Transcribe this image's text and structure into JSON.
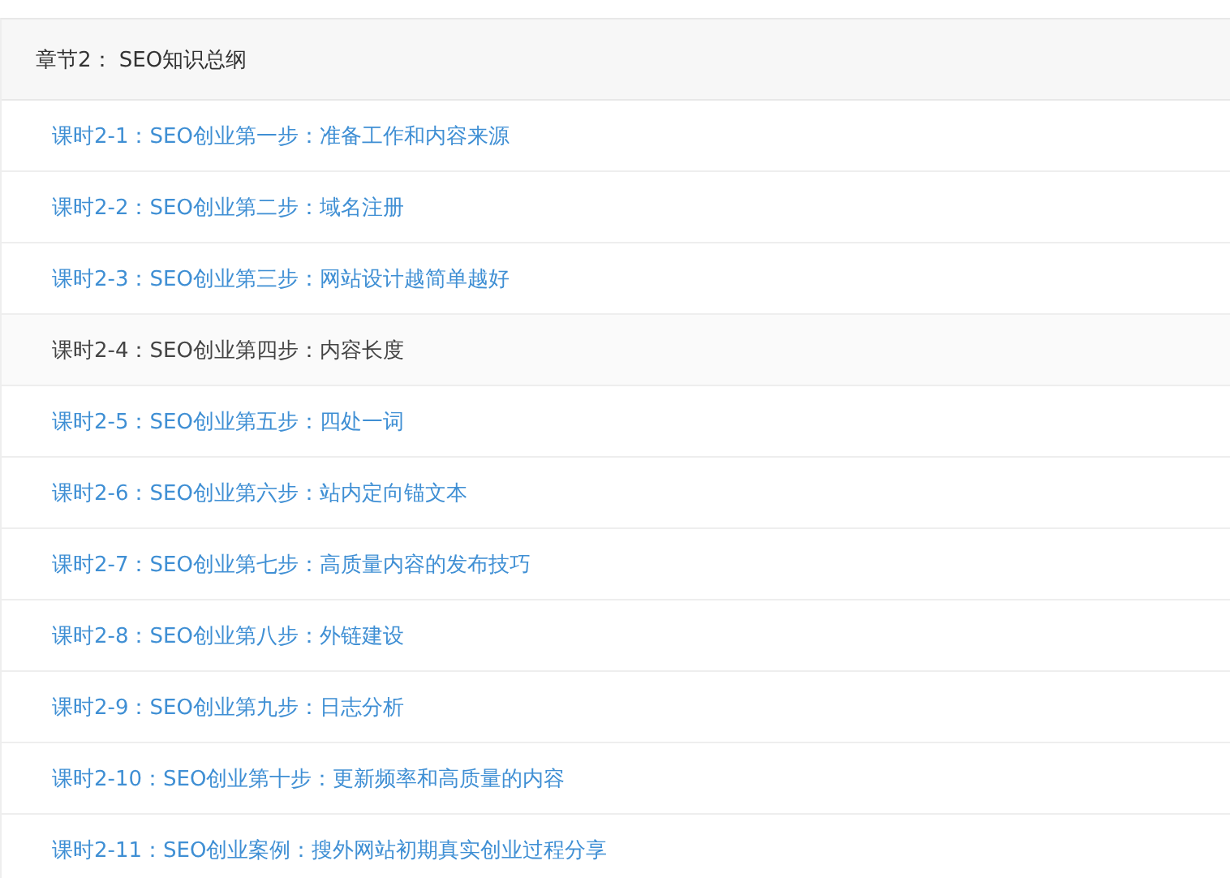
{
  "chapter": {
    "title": "章节2： SEO知识总纲"
  },
  "lessons": [
    {
      "label": "课时2-1：SEO创业第一步：准备工作和内容来源",
      "selected": false
    },
    {
      "label": "课时2-2：SEO创业第二步：域名注册",
      "selected": false
    },
    {
      "label": "课时2-3：SEO创业第三步：网站设计越简单越好",
      "selected": false
    },
    {
      "label": "课时2-4：SEO创业第四步：内容长度",
      "selected": true
    },
    {
      "label": "课时2-5：SEO创业第五步：四处一词",
      "selected": false
    },
    {
      "label": "课时2-6：SEO创业第六步：站内定向锚文本",
      "selected": false
    },
    {
      "label": "课时2-7：SEO创业第七步：高质量内容的发布技巧",
      "selected": false
    },
    {
      "label": "课时2-8：SEO创业第八步：外链建设",
      "selected": false
    },
    {
      "label": "课时2-9：SEO创业第九步：日志分析",
      "selected": false
    },
    {
      "label": "课时2-10：SEO创业第十步：更新频率和高质量的内容",
      "selected": false
    },
    {
      "label": "课时2-11：SEO创业案例：搜外网站初期真实创业过程分享",
      "selected": false
    }
  ]
}
